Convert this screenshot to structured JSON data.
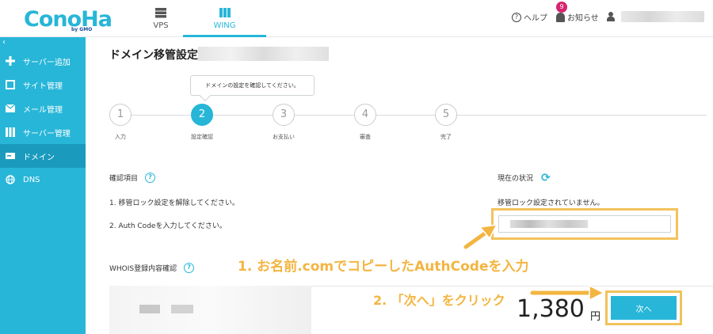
{
  "header": {
    "logo": "ConoHa",
    "logo_sub": "by GMO",
    "tabs": [
      {
        "label": "VPS"
      },
      {
        "label": "WING"
      }
    ],
    "help_label": "ヘルプ",
    "notice_label": "お知らせ",
    "notice_count": "9"
  },
  "sidebar": {
    "collapse": "‹",
    "items": [
      {
        "label": "サーバー追加",
        "icon": "plus-icon"
      },
      {
        "label": "サイト管理",
        "icon": "window-icon"
      },
      {
        "label": "メール管理",
        "icon": "mail-icon"
      },
      {
        "label": "サーバー管理",
        "icon": "server-icon"
      },
      {
        "label": "ドメイン",
        "icon": "domain-icon"
      },
      {
        "label": "DNS",
        "icon": "globe-icon"
      }
    ]
  },
  "page": {
    "title": "ドメイン移管設定",
    "tooltip": "ドメインの設定を確認してください。",
    "steps": [
      {
        "num": "1",
        "label": "入力"
      },
      {
        "num": "2",
        "label": "設定確認"
      },
      {
        "num": "3",
        "label": "お支払い"
      },
      {
        "num": "4",
        "label": "審査"
      },
      {
        "num": "5",
        "label": "完了"
      }
    ],
    "check_title": "確認項目",
    "check_items": [
      "1. 移管ロック設定を解除してください。",
      "2. Auth Codeを入力してください。"
    ],
    "status_title": "現在の状況",
    "status_text": "移管ロック設定されていません。",
    "whois_title": "WHOIS登録内容確認",
    "price": "1,380",
    "yen": "円",
    "next_button": "次へ"
  },
  "annotations": {
    "first": "1. お名前.comでコピーしたAuthCodeを入力",
    "second": "2. 「次へ」をクリック"
  },
  "colors": {
    "accent": "#27b6d8",
    "highlight": "#f3c25c",
    "badge": "#d6246e"
  }
}
